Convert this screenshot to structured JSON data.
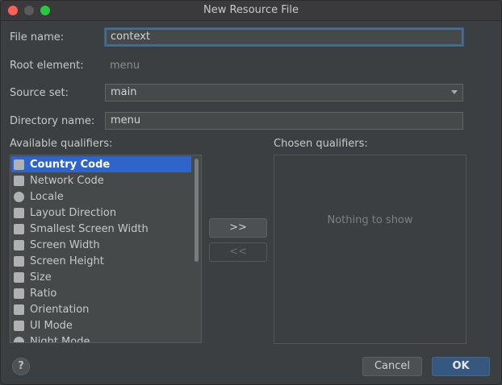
{
  "window": {
    "title": "New Resource File"
  },
  "form": {
    "file_name_label": "File name:",
    "file_name_value": "context",
    "root_element_label": "Root element:",
    "root_element_value": "menu",
    "source_set_label": "Source set:",
    "source_set_value": "main",
    "directory_name_label": "Directory name:",
    "directory_name_value": "menu"
  },
  "qualifiers": {
    "available_label": "Available qualifiers:",
    "chosen_label": "Chosen qualifiers:",
    "add_label": ">>",
    "remove_label": "<<",
    "empty_text": "Nothing to show",
    "items": [
      {
        "label": "Country Code",
        "icon": "country-code-icon",
        "selected": true
      },
      {
        "label": "Network Code",
        "icon": "network-code-icon"
      },
      {
        "label": "Locale",
        "icon": "globe-icon"
      },
      {
        "label": "Layout Direction",
        "icon": "layout-direction-icon"
      },
      {
        "label": "Smallest Screen Width",
        "icon": "smallest-screen-width-icon"
      },
      {
        "label": "Screen Width",
        "icon": "screen-width-icon"
      },
      {
        "label": "Screen Height",
        "icon": "screen-height-icon"
      },
      {
        "label": "Size",
        "icon": "size-icon"
      },
      {
        "label": "Ratio",
        "icon": "ratio-icon"
      },
      {
        "label": "Orientation",
        "icon": "orientation-icon"
      },
      {
        "label": "UI Mode",
        "icon": "ui-mode-icon"
      },
      {
        "label": "Night Mode",
        "icon": "night-mode-icon"
      }
    ]
  },
  "buttons": {
    "help": "?",
    "cancel": "Cancel",
    "ok": "OK"
  },
  "colors": {
    "accent": "#2f65ca",
    "ok_button": "#365880",
    "background": "#3c3f41"
  }
}
